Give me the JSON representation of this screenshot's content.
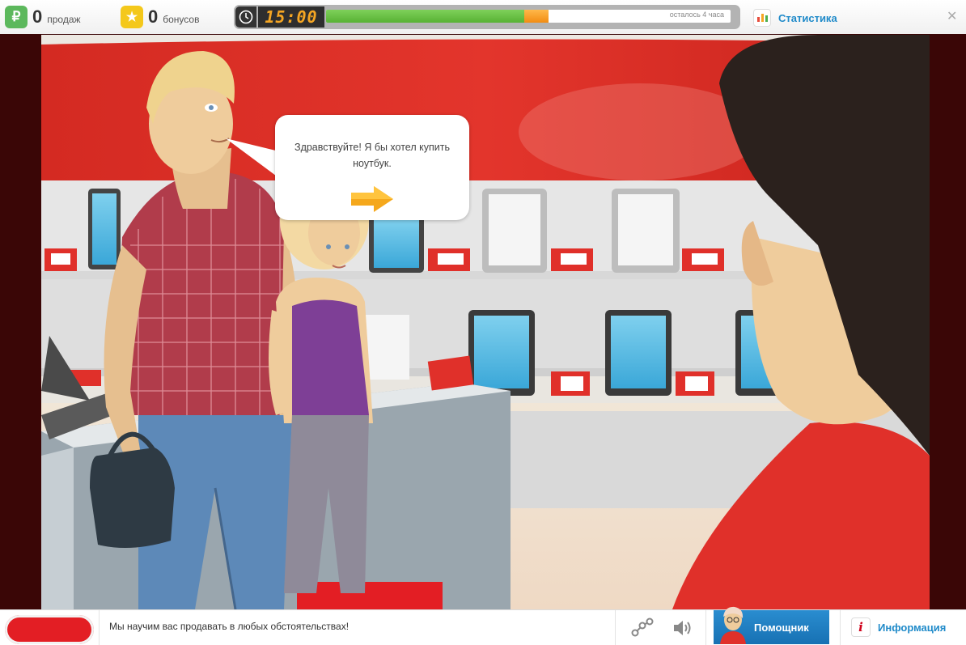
{
  "stats": {
    "sales": {
      "value": "0",
      "label": "продаж",
      "icon": "ruble-icon",
      "color": "#5cb85c"
    },
    "bonuses": {
      "value": "0",
      "label": "бонусов",
      "icon": "star-icon",
      "color": "#f4c81b"
    }
  },
  "timer": {
    "display": "15:00",
    "icon": "clock-icon",
    "remaining_text": "осталось 4 часа",
    "progress_green": 0.49,
    "progress_orange": 0.06
  },
  "header": {
    "statistics_label": "Статистика",
    "statistics_icon": "bar-chart-icon",
    "close_icon": "close-icon"
  },
  "dialog": {
    "speech": "Здравствуйте! Я бы хотел купить ноутбук.",
    "next_icon": "next-arrow-icon"
  },
  "footer": {
    "ticker": "Мы научим вас продавать в любых обстоятельствах!",
    "share_icon": "share-icon",
    "sound_icon": "speaker-icon",
    "helper_label": "Помощник",
    "info_label": "Информация",
    "info_icon": "info-icon"
  },
  "colors": {
    "accent_blue": "#1f8ac9",
    "store_red": "#e0302a",
    "frame_dark": "#3a0606"
  }
}
